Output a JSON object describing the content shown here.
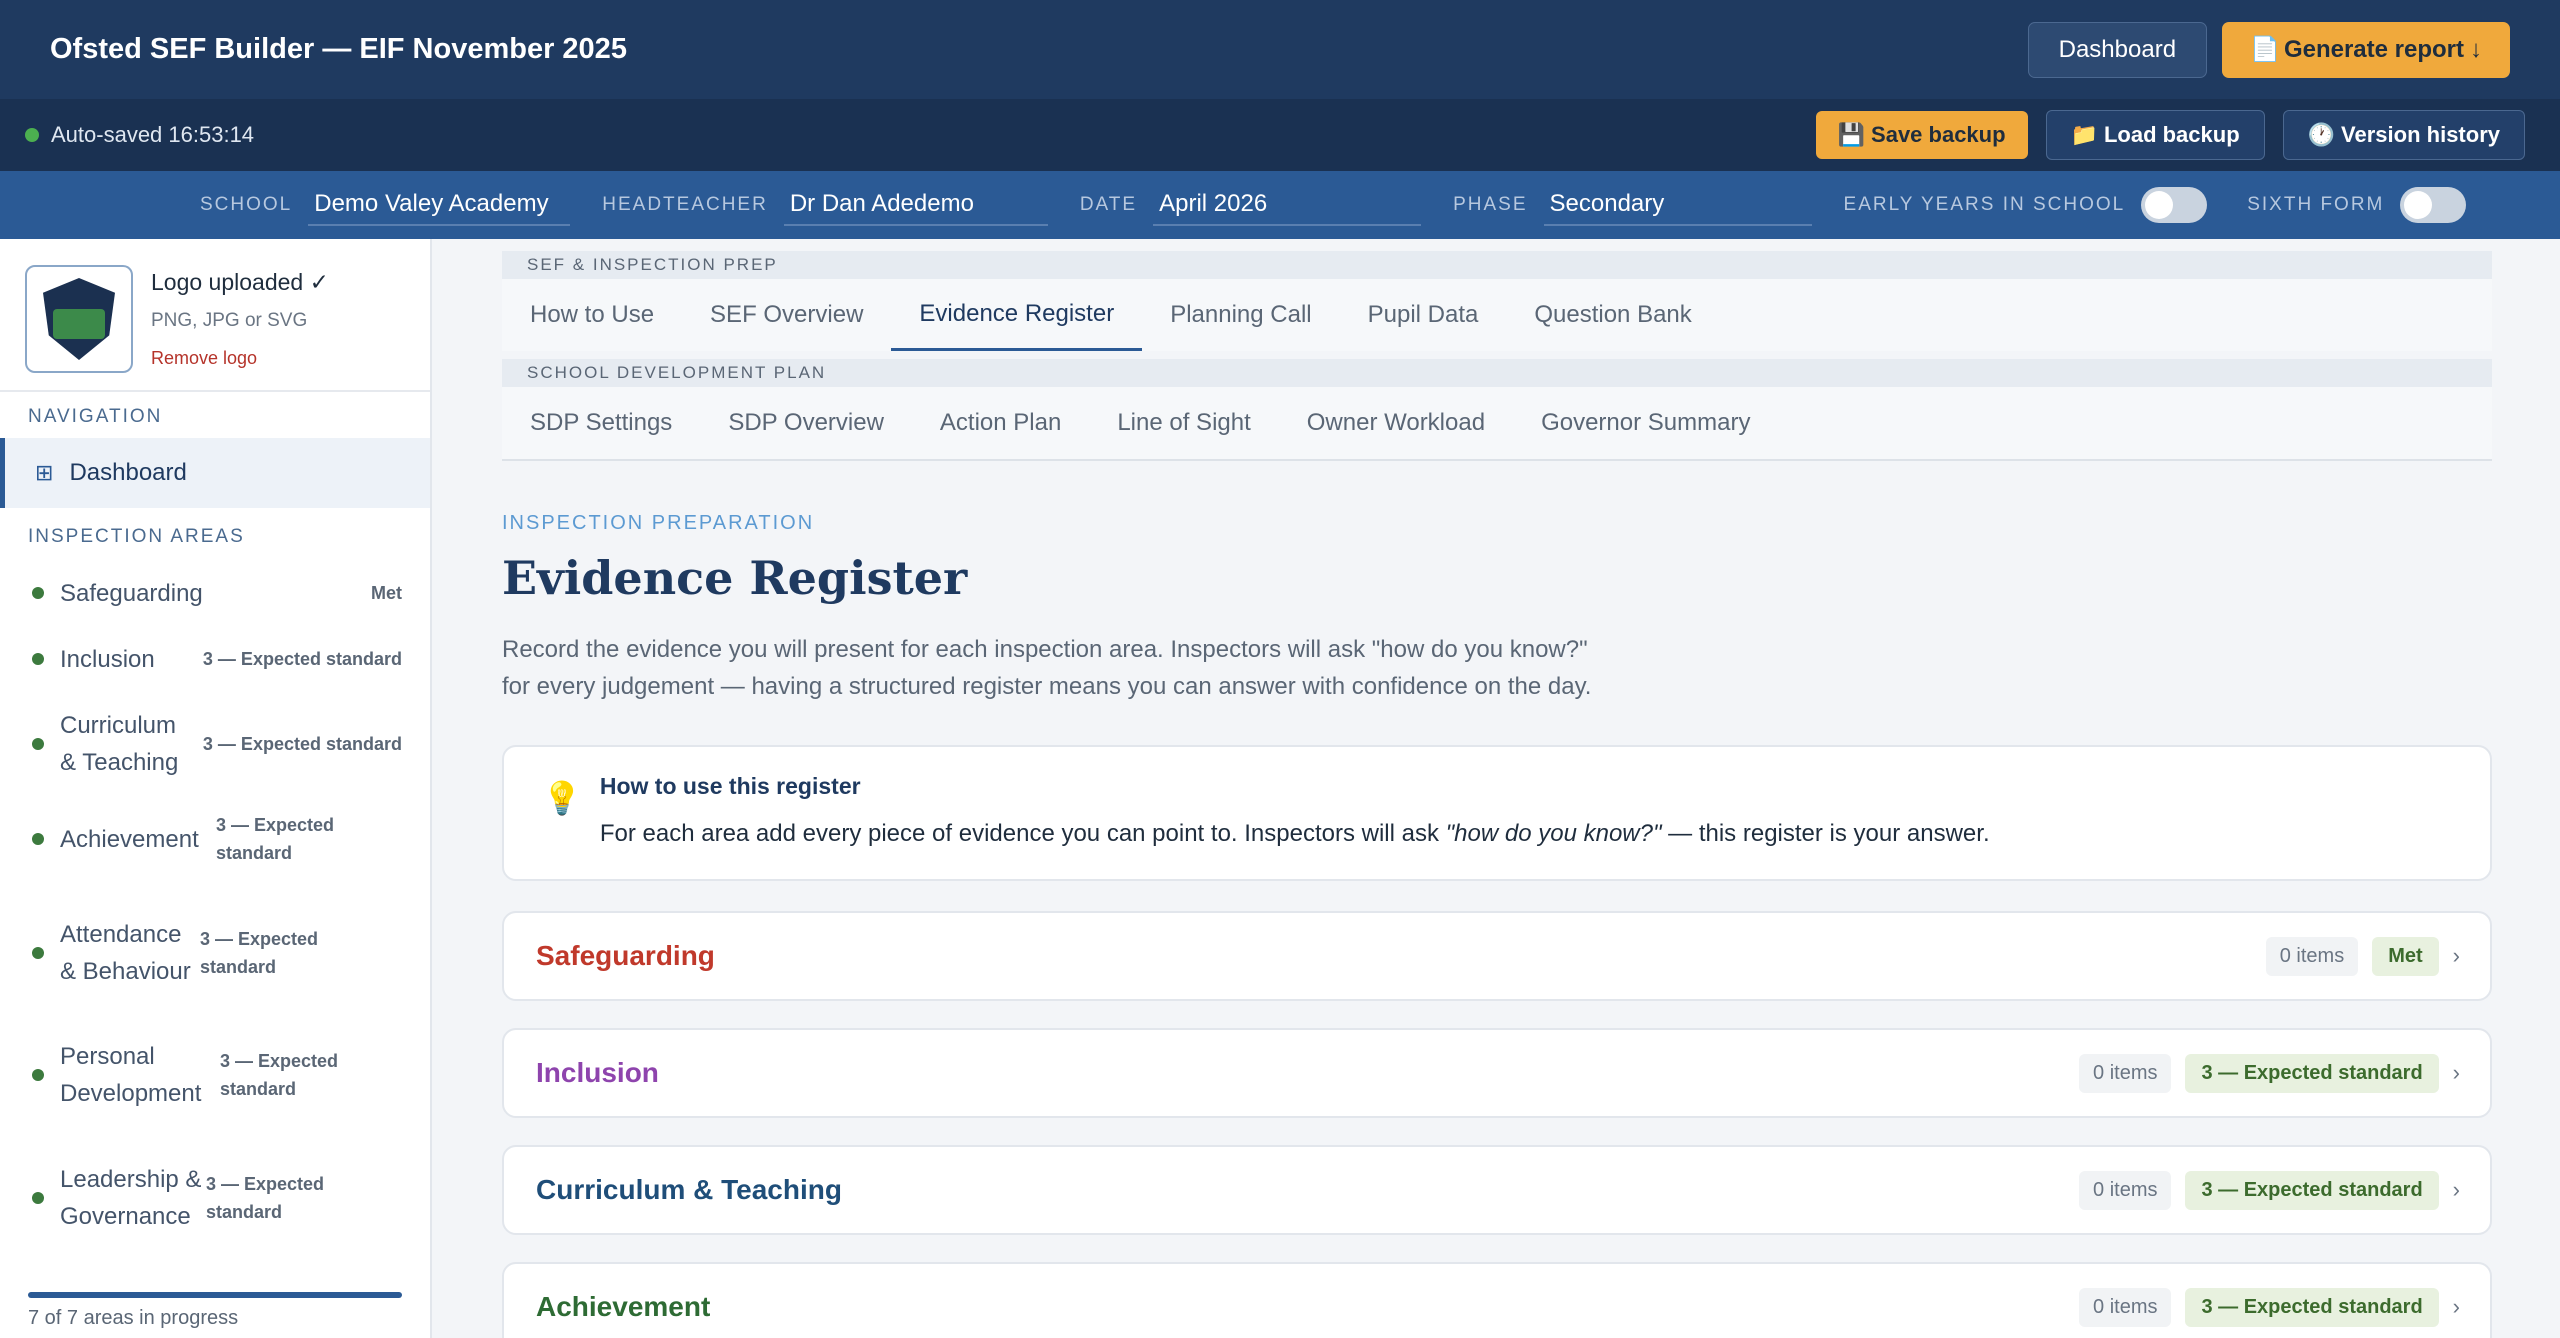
{
  "header": {
    "title": "Ofsted SEF Builder — EIF November 2025",
    "dashboard_label": "Dashboard",
    "generate_icon": "📄",
    "generate_label": "Generate report",
    "generate_arrow": "↓"
  },
  "savebar": {
    "autosave_text": "Auto-saved 16:53:14",
    "save_icon": "💾",
    "save_label": "Save backup",
    "load_icon": "📁",
    "load_label": "Load backup",
    "history_icon": "🕐",
    "history_label": "Version history"
  },
  "fields": {
    "school_label": "SCHOOL",
    "school_value": "Demo Valey Academy",
    "head_label": "HEADTEACHER",
    "head_value": "Dr Dan Adedemo",
    "date_label": "DATE",
    "date_value": "April 2026",
    "phase_label": "PHASE",
    "phase_value": "Secondary",
    "early_years_label": "EARLY YEARS IN SCHOOL",
    "early_years_on": false,
    "sixth_form_label": "SIXTH FORM",
    "sixth_form_on": false
  },
  "sidebar": {
    "logo_title": "Logo uploaded ✓",
    "logo_sub": "PNG, JPG or SVG",
    "logo_remove": "Remove logo",
    "nav_heading": "NAVIGATION",
    "nav_dashboard": "Dashboard",
    "areas_heading": "INSPECTION AREAS",
    "areas": [
      {
        "name": "Safeguarding",
        "status": "Met"
      },
      {
        "name": "Inclusion",
        "status": "3 — Expected standard"
      },
      {
        "name": "Curriculum & Teaching",
        "status": "3 — Expected standard"
      },
      {
        "name": "Achievement",
        "status": "3 — Expected standard"
      },
      {
        "name": "Attendance & Behaviour",
        "status": "3 — Expected standard"
      },
      {
        "name": "Personal Development",
        "status": "3 — Expected standard"
      },
      {
        "name": "Leadership & Governance",
        "status": "3 — Expected standard"
      }
    ],
    "progress_fraction": 1.0,
    "progress_text": "7 of 7 areas in progress"
  },
  "tabs": {
    "group1_heading": "SEF & INSPECTION PREP",
    "group1": [
      "How to Use",
      "SEF Overview",
      "Evidence Register",
      "Planning Call",
      "Pupil Data",
      "Question Bank"
    ],
    "group2_heading": "SCHOOL DEVELOPMENT PLAN",
    "group2": [
      "SDP Settings",
      "SDP Overview",
      "Action Plan",
      "Line of Sight",
      "Owner Workload",
      "Governor Summary"
    ],
    "active": "Evidence Register"
  },
  "page": {
    "eyebrow": "INSPECTION PREPARATION",
    "title": "Evidence Register",
    "intro_line1": "Record the evidence you will present for each inspection area. Inspectors will ask \"how do you know?\"",
    "intro_line2": "for every judgement — having a structured register means you can answer with confidence on the day.",
    "tip_title": "How to use this register",
    "tip_text_before": "For each area add every piece of evidence you can point to. Inspectors will ask ",
    "tip_text_em": "\"how do you know?\"",
    "tip_text_after": " — this register is your answer."
  },
  "evidence_areas": [
    {
      "name": "Safeguarding",
      "items": "0 items",
      "judgement": "Met",
      "color": "#c0392b"
    },
    {
      "name": "Inclusion",
      "items": "0 items",
      "judgement": "3 — Expected standard",
      "color": "#8e44ad"
    },
    {
      "name": "Curriculum & Teaching",
      "items": "0 items",
      "judgement": "3 — Expected standard",
      "color": "#1f4e79"
    },
    {
      "name": "Achievement",
      "items": "0 items",
      "judgement": "3 — Expected standard",
      "color": "#2e6b34"
    }
  ]
}
